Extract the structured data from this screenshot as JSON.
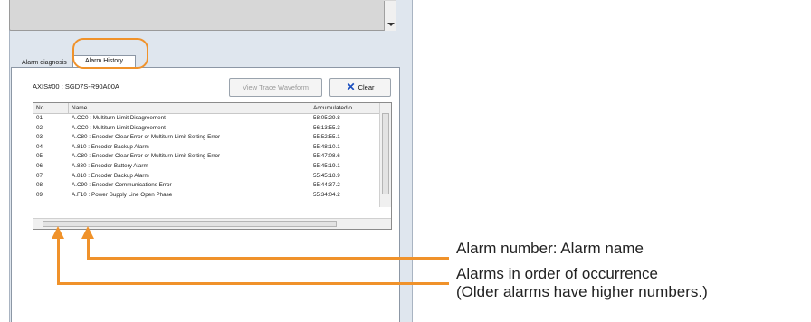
{
  "tabs": {
    "diagnosis": "Alarm diagnosis",
    "history": "Alarm History"
  },
  "axis": "AXIS#00 : SGD7S-R90A00A",
  "buttons": {
    "trace": "View Trace Waveform",
    "clear": "Clear"
  },
  "table": {
    "headers": [
      "No.",
      "Name",
      "Accumulated o..."
    ],
    "rows": [
      [
        "01",
        "A.CC0 : Multiturn Limit Disagreement",
        "58:05:29.8"
      ],
      [
        "02",
        "A.CC0 : Multiturn Limit Disagreement",
        "56:13:55.3"
      ],
      [
        "03",
        "A.C80 : Encoder Clear Error or Multiturn Limit Setting Error",
        "55:52:55.1"
      ],
      [
        "04",
        "A.810 : Encoder Backup Alarm",
        "55:48:10.1"
      ],
      [
        "05",
        "A.C80 : Encoder Clear Error or Multiturn Limit Setting Error",
        "55:47:08.6"
      ],
      [
        "06",
        "A.830 : Encoder Battery Alarm",
        "55:45:19.1"
      ],
      [
        "07",
        "A.810 : Encoder Backup Alarm",
        "55:45:18.9"
      ],
      [
        "08",
        "A.C90 : Encoder Communications Error",
        "55:44:37.2"
      ],
      [
        "09",
        "A.F10 : Power Supply Line Open Phase",
        "55:34:04.2"
      ]
    ]
  },
  "callouts": {
    "alarm_number": "Alarm number: Alarm name",
    "order_line1": "Alarms in order of occurrence",
    "order_line2": "(Older alarms have higher numbers.)"
  },
  "colors": {
    "accent": "#f0922a",
    "clear_icon": "#1b4fbf"
  }
}
